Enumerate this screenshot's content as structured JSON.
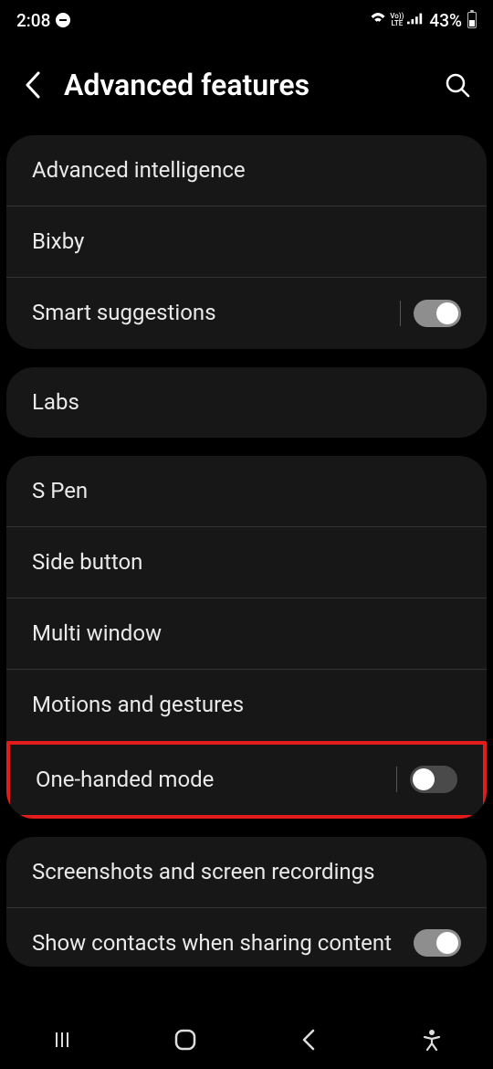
{
  "status": {
    "time": "2:08",
    "wifi": "wifi6",
    "volte": "Vo))\nLTE",
    "battery_pct": "43%"
  },
  "header": {
    "title": "Advanced features"
  },
  "group1": {
    "advanced_intelligence": "Advanced intelligence",
    "bixby": "Bixby",
    "smart_suggestions": "Smart suggestions"
  },
  "group2": {
    "labs": "Labs"
  },
  "group3": {
    "s_pen": "S Pen",
    "side_button": "Side button",
    "multi_window": "Multi window",
    "motions_gestures": "Motions and gestures",
    "one_handed": "One-handed mode"
  },
  "group4": {
    "screenshots": "Screenshots and screen recordings",
    "show_contacts": "Show contacts when sharing content"
  },
  "toggles": {
    "smart_suggestions": "on",
    "one_handed": "off",
    "show_contacts": "on"
  }
}
